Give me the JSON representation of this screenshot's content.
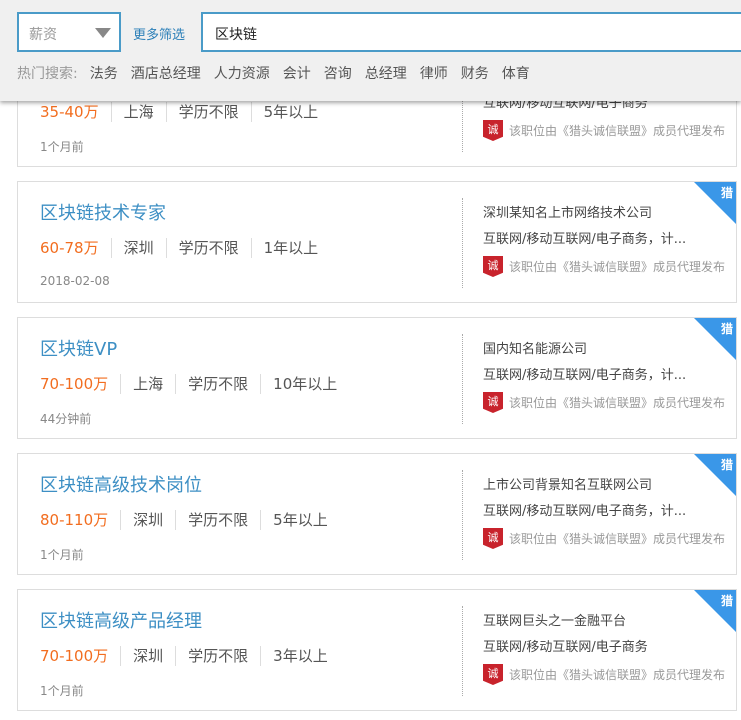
{
  "filter": {
    "salary_label": "薪资",
    "more_label": "更多筛选",
    "search_value": "区块链"
  },
  "hot": {
    "label": "热门搜索:",
    "keywords": [
      "法务",
      "酒店总经理",
      "人力资源",
      "会计",
      "咨询",
      "总经理",
      "律师",
      "财务",
      "体育"
    ]
  },
  "publisher_text": "该职位由《猎头诚信联盟》成员代理发布",
  "badge_text": "诚",
  "corner_text": "猎",
  "jobs": [
    {
      "title": "",
      "salary": "35-40万",
      "city": "上海",
      "edu": "学历不限",
      "exp": "5年以上",
      "time": "1个月前",
      "company": "",
      "industry": "互联网/移动互联网/电子商务"
    },
    {
      "title": "区块链技术专家",
      "salary": "60-78万",
      "city": "深圳",
      "edu": "学历不限",
      "exp": "1年以上",
      "time": "2018-02-08",
      "company": "深圳某知名上市网络技术公司",
      "industry": "互联网/移动互联网/电子商务，计..."
    },
    {
      "title": "区块链VP",
      "salary": "70-100万",
      "city": "上海",
      "edu": "学历不限",
      "exp": "10年以上",
      "time": "44分钟前",
      "company": "国内知名能源公司",
      "industry": "互联网/移动互联网/电子商务，计..."
    },
    {
      "title": "区块链高级技术岗位",
      "salary": "80-110万",
      "city": "深圳",
      "edu": "学历不限",
      "exp": "5年以上",
      "time": "1个月前",
      "company": "上市公司背景知名互联网公司",
      "industry": "互联网/移动互联网/电子商务，计..."
    },
    {
      "title": "区块链高级产品经理",
      "salary": "70-100万",
      "city": "深圳",
      "edu": "学历不限",
      "exp": "3年以上",
      "time": "1个月前",
      "company": "互联网巨头之一金融平台",
      "industry": "互联网/移动互联网/电子商务"
    }
  ]
}
